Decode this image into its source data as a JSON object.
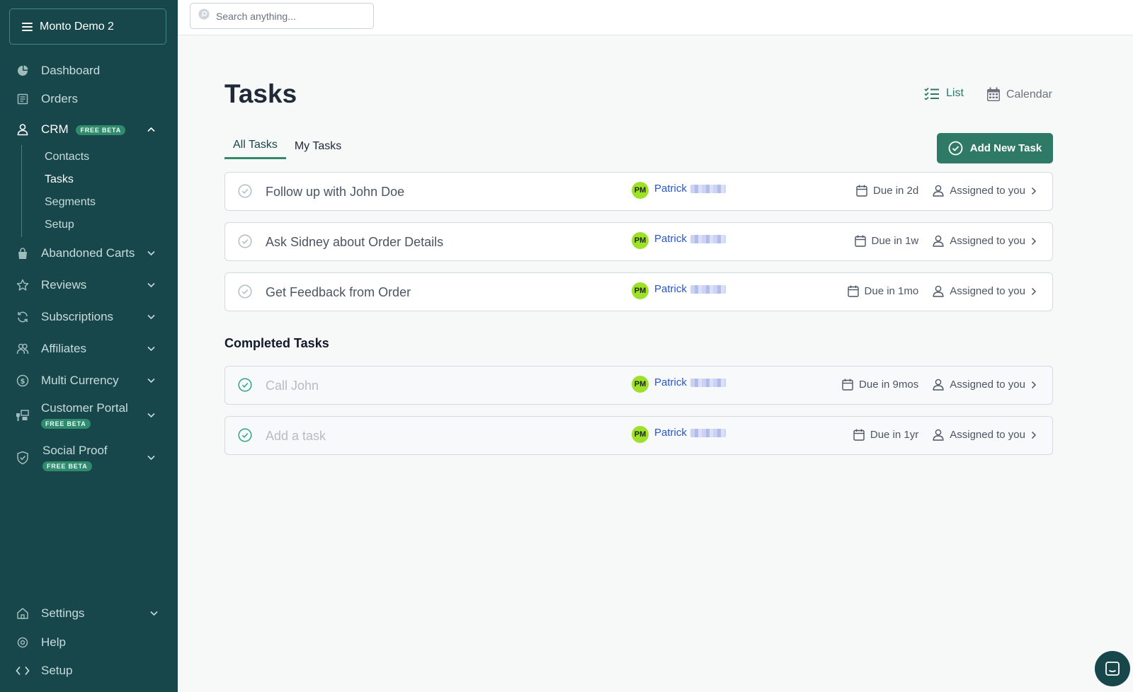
{
  "store": {
    "name": "Monto Demo 2"
  },
  "sidebar": {
    "items": [
      {
        "label": "Dashboard"
      },
      {
        "label": "Orders"
      },
      {
        "label": "CRM",
        "badge": "FREE BETA"
      },
      {
        "label": "Abandoned Carts"
      },
      {
        "label": "Reviews"
      },
      {
        "label": "Subscriptions"
      },
      {
        "label": "Affiliates"
      },
      {
        "label": "Multi Currency"
      },
      {
        "label": "Customer Portal",
        "badge": "FREE BETA"
      },
      {
        "label": "Social Proof",
        "badge": "FREE BETA"
      }
    ],
    "crm_sub": [
      {
        "label": "Contacts"
      },
      {
        "label": "Tasks"
      },
      {
        "label": "Segments"
      },
      {
        "label": "Setup"
      }
    ],
    "bottom": [
      {
        "label": "Settings"
      },
      {
        "label": "Help"
      },
      {
        "label": "Setup"
      }
    ]
  },
  "search": {
    "placeholder": "Search anything..."
  },
  "page": {
    "title": "Tasks"
  },
  "views": {
    "list": "List",
    "calendar": "Calendar"
  },
  "tabs": [
    {
      "label": "All Tasks"
    },
    {
      "label": "My Tasks"
    }
  ],
  "add_task_label": "Add New Task",
  "tasks": [
    {
      "title": "Follow up with John Doe",
      "owner_initials": "PM",
      "owner": "Patrick",
      "due": "Due in 2d",
      "assigned": "Assigned to you"
    },
    {
      "title": "Ask Sidney about Order Details",
      "owner_initials": "PM",
      "owner": "Patrick",
      "due": "Due in 1w",
      "assigned": "Assigned to you"
    },
    {
      "title": "Get Feedback from Order",
      "owner_initials": "PM",
      "owner": "Patrick",
      "due": "Due in 1mo",
      "assigned": "Assigned to you"
    }
  ],
  "completed_section_title": "Completed Tasks",
  "completed_tasks": [
    {
      "title": "Call John",
      "owner_initials": "PM",
      "owner": "Patrick",
      "due": "Due in 9mos",
      "assigned": "Assigned to you"
    },
    {
      "title": "Add a task",
      "owner_initials": "PM",
      "owner": "Patrick",
      "due": "Due in 1yr",
      "assigned": "Assigned to you"
    }
  ],
  "colors": {
    "sidebar": "#17464b",
    "accent": "#2f7a66",
    "avatar": "#9ee02a",
    "link": "#2b55c8"
  }
}
